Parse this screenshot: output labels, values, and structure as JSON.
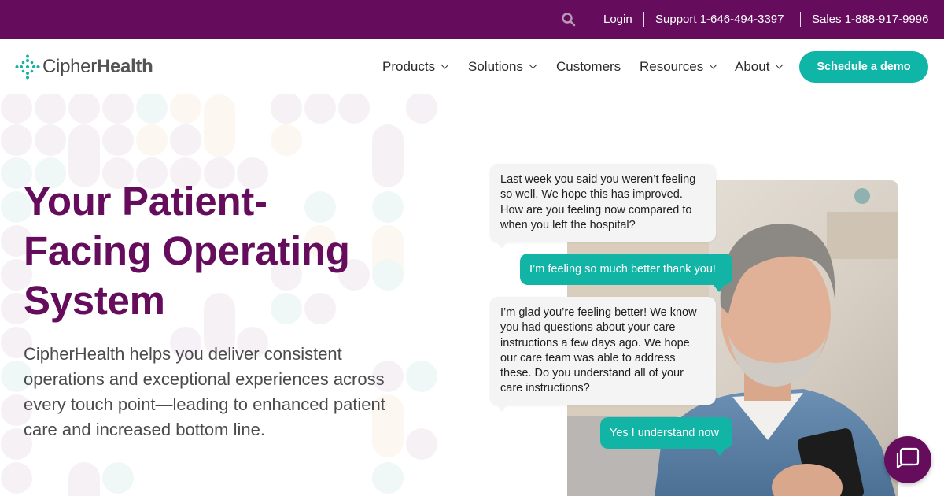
{
  "topbar": {
    "bg_color": "#650c5c",
    "search_icon": "search-icon",
    "login_label": "Login",
    "support_label": "Support",
    "support_phone": "1-646-494-3397",
    "sales_text": "Sales 1-888-917-9996"
  },
  "logo": {
    "text_light": "Cipher",
    "text_bold": "Health",
    "icon": "cross-dots-logo-icon"
  },
  "nav": {
    "items": [
      {
        "label": "Products",
        "has_dropdown": true
      },
      {
        "label": "Solutions",
        "has_dropdown": true
      },
      {
        "label": "Customers",
        "has_dropdown": false
      },
      {
        "label": "Resources",
        "has_dropdown": true
      },
      {
        "label": "About",
        "has_dropdown": true
      }
    ],
    "cta_label": "Schedule a demo",
    "cta_color": "#0fb5a6"
  },
  "hero": {
    "headline_lines": [
      "Your Patient-",
      "Facing Operating",
      "System"
    ],
    "headline_color": "#650c5c",
    "subtext": "CipherHealth helps you deliver consistent operations and exceptional experiences across every touch point—leading to enhanced patient care and increased bottom line."
  },
  "chat": {
    "messages": [
      {
        "from": "provider",
        "text": "Last week you said you weren’t feeling so well. We hope this has improved. How are you feeling now compared to when you left the hospital?"
      },
      {
        "from": "patient",
        "text": "I’m feeling so much better thank you!"
      },
      {
        "from": "provider",
        "text": "I’m glad you’re feeling better! We know you had questions about your care instructions a few days ago. We hope our care team was able to address these. Do you understand all of your care instructions?"
      },
      {
        "from": "patient",
        "text": "Yes I understand now"
      }
    ]
  },
  "widget": {
    "icon": "chat-bubble-icon"
  }
}
